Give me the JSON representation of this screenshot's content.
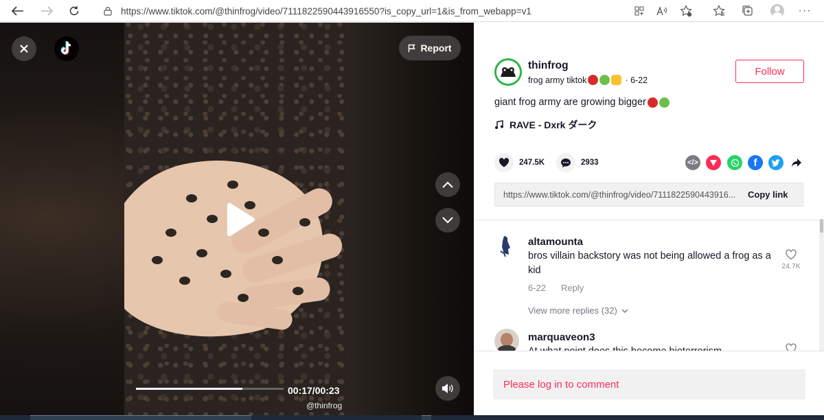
{
  "browser": {
    "url": "https://www.tiktok.com/@thinfrog/video/7111822590443916550?is_copy_url=1&is_from_webapp=v1",
    "icons": [
      "back-arrow-icon",
      "forward-arrow-icon",
      "refresh-icon",
      "lock-icon",
      "grid-icon",
      "read-aloud-icon",
      "add-favorite-icon",
      "favorites-icon",
      "collections-icon",
      "profile-icon",
      "more-icon"
    ]
  },
  "video": {
    "report_label": "Report",
    "time_overlay": "00:17/00:23",
    "watermark_handle": "@thinfrog",
    "progress": 0.72
  },
  "panel": {
    "author": "thinfrog",
    "sub_name": "frog army tiktok",
    "sub_date": "· 6-22",
    "follow_label": "Follow",
    "caption": "giant frog army are growing bigger",
    "music": "RAVE - Dxrk ダーク",
    "likes": "247.5K",
    "comments": "2933",
    "link": "https://www.tiktok.com/@thinfrog/video/7111822590443916...",
    "copy_label": "Copy link",
    "login_prompt": "Please log in to comment"
  },
  "comments": [
    {
      "user": "altamounta",
      "text": "bros villain backstory was not being allowed a frog as a kid",
      "date": "6-22",
      "reply": "Reply",
      "more_replies": "View more replies (32)",
      "likes": "24.7K"
    },
    {
      "user": "marquaveon3",
      "text": "At what point does this become bioterrorism"
    }
  ],
  "colors": {
    "accent": "#fe2c55",
    "avatar_ring": "#2db34a",
    "whatsapp": "#25d366",
    "facebook": "#1877f2",
    "twitter": "#1da1f2"
  }
}
